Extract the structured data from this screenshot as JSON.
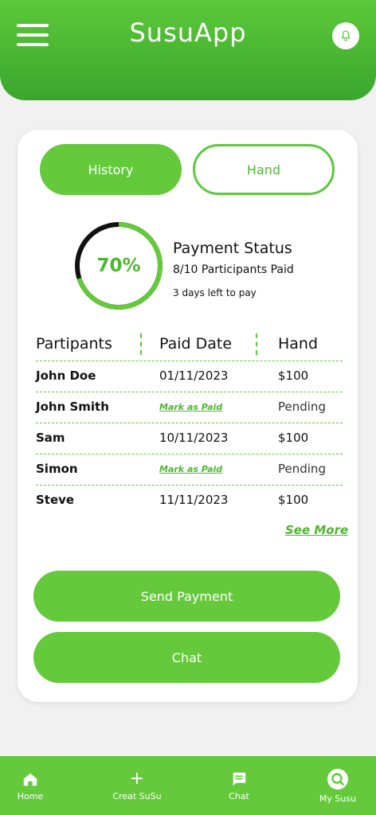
{
  "header": {
    "title": "SusuApp",
    "menu_icon": "hamburger-menu-icon",
    "notification_icon": "bell-icon"
  },
  "tabs": [
    {
      "label": "History",
      "active": true
    },
    {
      "label": "Hand",
      "active": false
    }
  ],
  "payment_status": {
    "percent_label": "70%",
    "progress_fraction": 0.7,
    "title": "Payment Status",
    "paid_summary": "8/10 Participants Paid",
    "days_left": "3 days left to pay"
  },
  "table": {
    "headers": [
      "Partipants",
      "Paid Date",
      "Hand"
    ],
    "rows": [
      {
        "name": "John Doe",
        "date": "01/11/2023",
        "hand": "$100"
      },
      {
        "name": "John Smith",
        "date": "Mark as Paid",
        "hand": "Pending"
      },
      {
        "name": "Sam",
        "date": "10/11/2023",
        "hand": "$100"
      },
      {
        "name": "Simon",
        "date": "Mark as Paid",
        "hand": "Pending"
      },
      {
        "name": "Steve",
        "date": "11/11/2023",
        "hand": "$100"
      }
    ],
    "see_more": "See More"
  },
  "actions": {
    "send_payment": "Send Payment",
    "chat": "Chat"
  },
  "bottom_nav": [
    {
      "label": "Home",
      "icon": "home-icon"
    },
    {
      "label": "Creat SuSu",
      "icon": "plus-icon"
    },
    {
      "label": "Chat",
      "icon": "chat-icon"
    },
    {
      "label": "My Susu",
      "icon": "search-icon"
    }
  ],
  "colors": {
    "primary": "#64c93b",
    "primary_dark": "#3aa62d",
    "ring_remaining": "#111111"
  }
}
